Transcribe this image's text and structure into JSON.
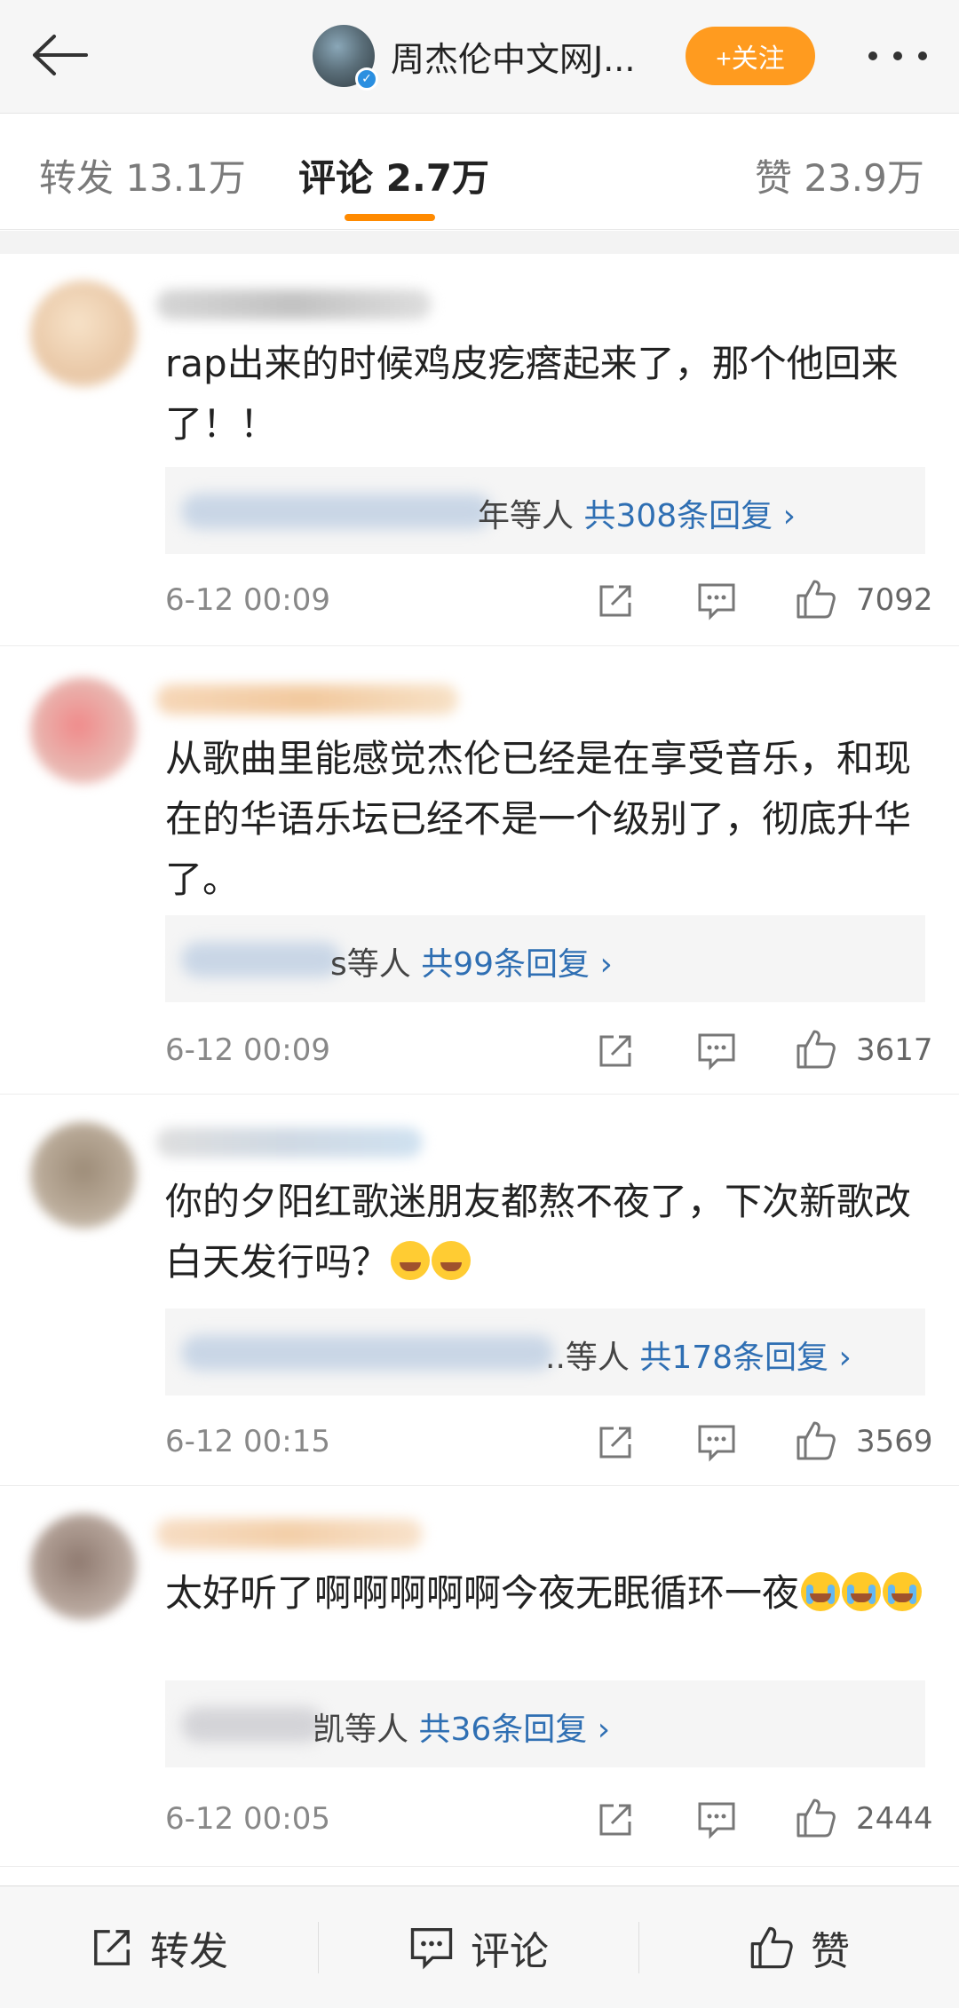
{
  "header": {
    "title": "周杰伦中文网J...",
    "follow_label": "+关注"
  },
  "tabs": [
    {
      "label": "转发 13.1万"
    },
    {
      "label": "评论 2.7万"
    },
    {
      "label": "赞 23.9万"
    }
  ],
  "comments": [
    {
      "text": "rap出来的时候鸡皮疙瘩起来了，那个他回来了！！",
      "reply_prefix": "年等人",
      "reply_count": "共308条回复 ›",
      "time": "6-12 00:09",
      "likes": "7092"
    },
    {
      "text": "从歌曲里能感觉杰伦已经是在享受音乐，和现在的华语乐坛已经不是一个级别了，彻底升华了。",
      "reply_prefix": "s等人",
      "reply_count": "共99条回复 ›",
      "time": "6-12 00:09",
      "likes": "3617"
    },
    {
      "text": "你的夕阳红歌迷朋友都熬不夜了，下次新歌改白天发行吗？",
      "reply_prefix": "..等人",
      "reply_count": "共178条回复 ›",
      "time": "6-12 00:15",
      "likes": "3569"
    },
    {
      "text": "太好听了啊啊啊啊啊今夜无眠循环一夜",
      "reply_prefix": "凯等人",
      "reply_count": "共36条回复 ›",
      "time": "6-12 00:05",
      "likes": "2444"
    }
  ],
  "bottom": {
    "repost": "转发",
    "comment": "评论",
    "like": "赞"
  },
  "colors": {
    "accent_orange": "#ff9b1f",
    "link_blue": "#2f6fb3"
  }
}
